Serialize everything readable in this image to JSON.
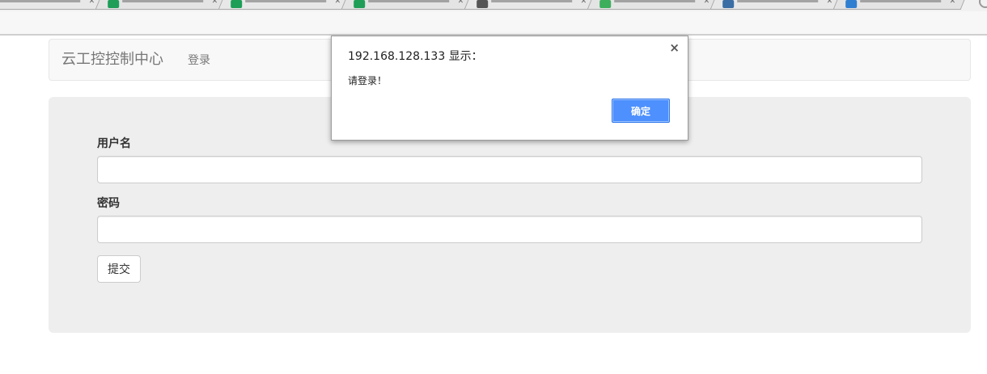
{
  "browser": {
    "tabs": [
      {
        "favicon_color": "#4a6a2a"
      },
      {
        "favicon_color": "#1e9e57"
      },
      {
        "favicon_color": "#1e9e57"
      },
      {
        "favicon_color": "#1e9e57"
      },
      {
        "favicon_color": "#555555"
      },
      {
        "favicon_color": "#3cae5c"
      },
      {
        "favicon_color": "#3a6ea5"
      },
      {
        "favicon_color": "#2f7fd1"
      }
    ]
  },
  "navbar": {
    "brand": "云工控控制中心",
    "login_link": "登录"
  },
  "form": {
    "username_label": "用户名",
    "username_value": "",
    "password_label": "密码",
    "password_value": "",
    "submit_label": "提交"
  },
  "dialog": {
    "title": "192.168.128.133 显示：",
    "close_glyph": "×",
    "message": "请登录！",
    "ok_label": "确定",
    "ok_color": "#4d90fe"
  }
}
